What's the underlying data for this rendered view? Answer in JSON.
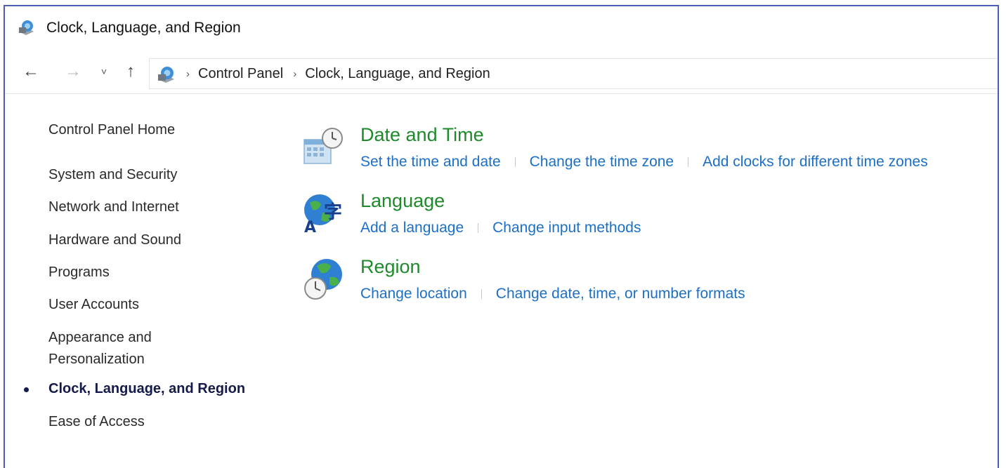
{
  "window": {
    "title": "Clock, Language, and Region",
    "border_color": "#4a5fb5"
  },
  "nav": {
    "back_icon": "←",
    "forward_icon": "→",
    "recent_icon": "˅",
    "up_icon": "↑",
    "separator": "›",
    "breadcrumbs": [
      "Control Panel",
      "Clock, Language, and Region"
    ]
  },
  "sidebar": {
    "items": [
      {
        "label": "Control Panel Home"
      },
      {
        "label": "System and Security"
      },
      {
        "label": "Network and Internet"
      },
      {
        "label": "Hardware and Sound"
      },
      {
        "label": "Programs"
      },
      {
        "label": "User Accounts"
      },
      {
        "label": "Appearance and"
      },
      {
        "label": "Personalization"
      },
      {
        "label": "Clock, Language, and Region"
      },
      {
        "label": "Ease of Access"
      }
    ],
    "active": "Clock, Language, and Region"
  },
  "categories": [
    {
      "title": "Date and Time",
      "icon": "date-time-icon",
      "links": [
        "Set the time and date",
        "Change the time zone",
        "Add clocks for different time zones"
      ]
    },
    {
      "title": "Language",
      "icon": "language-icon",
      "links": [
        "Add a language",
        "Change input methods"
      ]
    },
    {
      "title": "Region",
      "icon": "region-icon",
      "links": [
        "Change location",
        "Change date, time, or number formats"
      ]
    }
  ],
  "colors": {
    "category_title": "#1e8a2c",
    "link": "#1c6fc6",
    "active_item": "#141b4a"
  }
}
